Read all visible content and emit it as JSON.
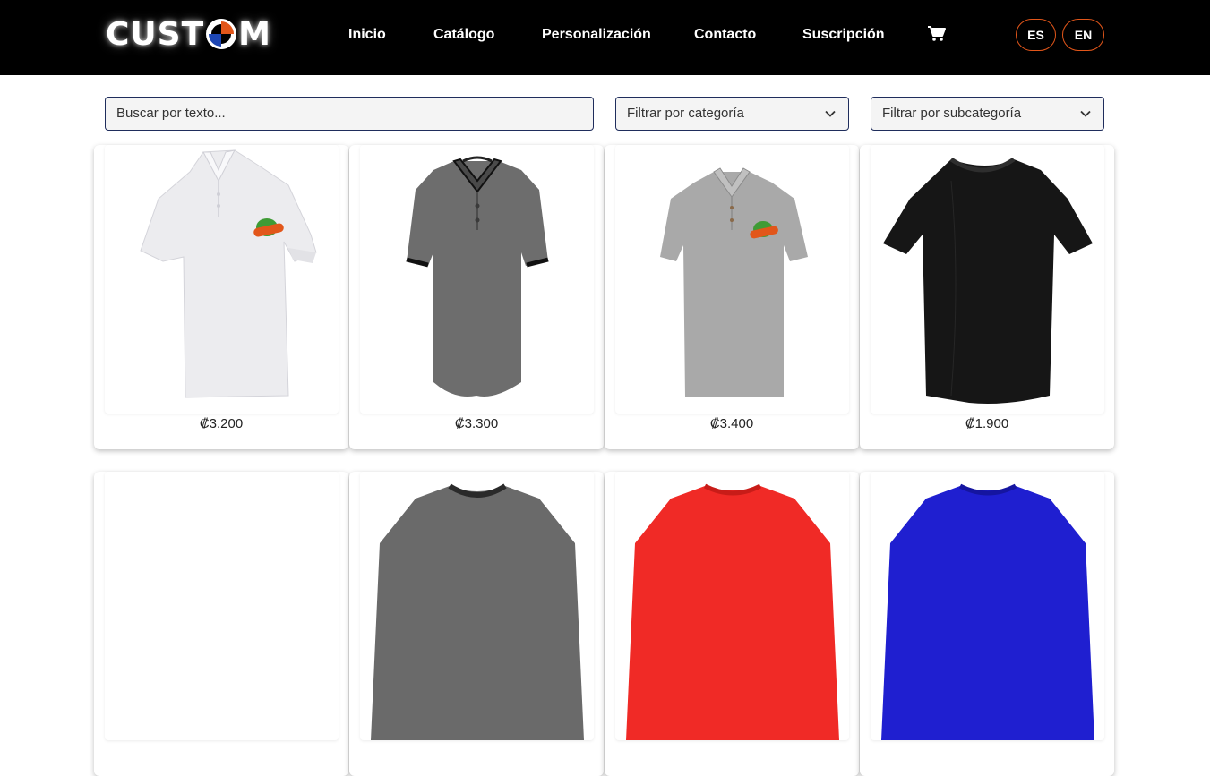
{
  "header": {
    "logo_text_left": "CUST",
    "logo_text_right": "M",
    "nav": [
      {
        "label": "Inicio"
      },
      {
        "label": "Catálogo"
      },
      {
        "label": "Personalización"
      },
      {
        "label": "Contacto"
      },
      {
        "label": "Suscripción"
      }
    ],
    "cart_icon": "cart-icon",
    "languages": [
      "ES",
      "EN"
    ]
  },
  "filters": {
    "search_placeholder": "Buscar por texto...",
    "category_label": "Filtrar por categoría",
    "subcategory_label": "Filtrar por subcategoría"
  },
  "products": [
    {
      "price": "₡3.200",
      "image": "white polo shirt with logo"
    },
    {
      "price": "₡3.300",
      "image": "gray polo shirt with black trim"
    },
    {
      "price": "₡3.400",
      "image": "heather gray polo shirt with logo"
    },
    {
      "price": "₡1.900",
      "image": "black t-shirt"
    },
    {
      "price": "",
      "image": "blank"
    },
    {
      "price": "",
      "image": "gray t-shirt"
    },
    {
      "price": "",
      "image": "red t-shirt"
    },
    {
      "price": "",
      "image": "blue t-shirt"
    }
  ],
  "colors": {
    "header_bg": "#000000",
    "accent_orange": "#e2561a",
    "logo_blue": "#1d46b4",
    "input_border": "#1f2d5c"
  }
}
